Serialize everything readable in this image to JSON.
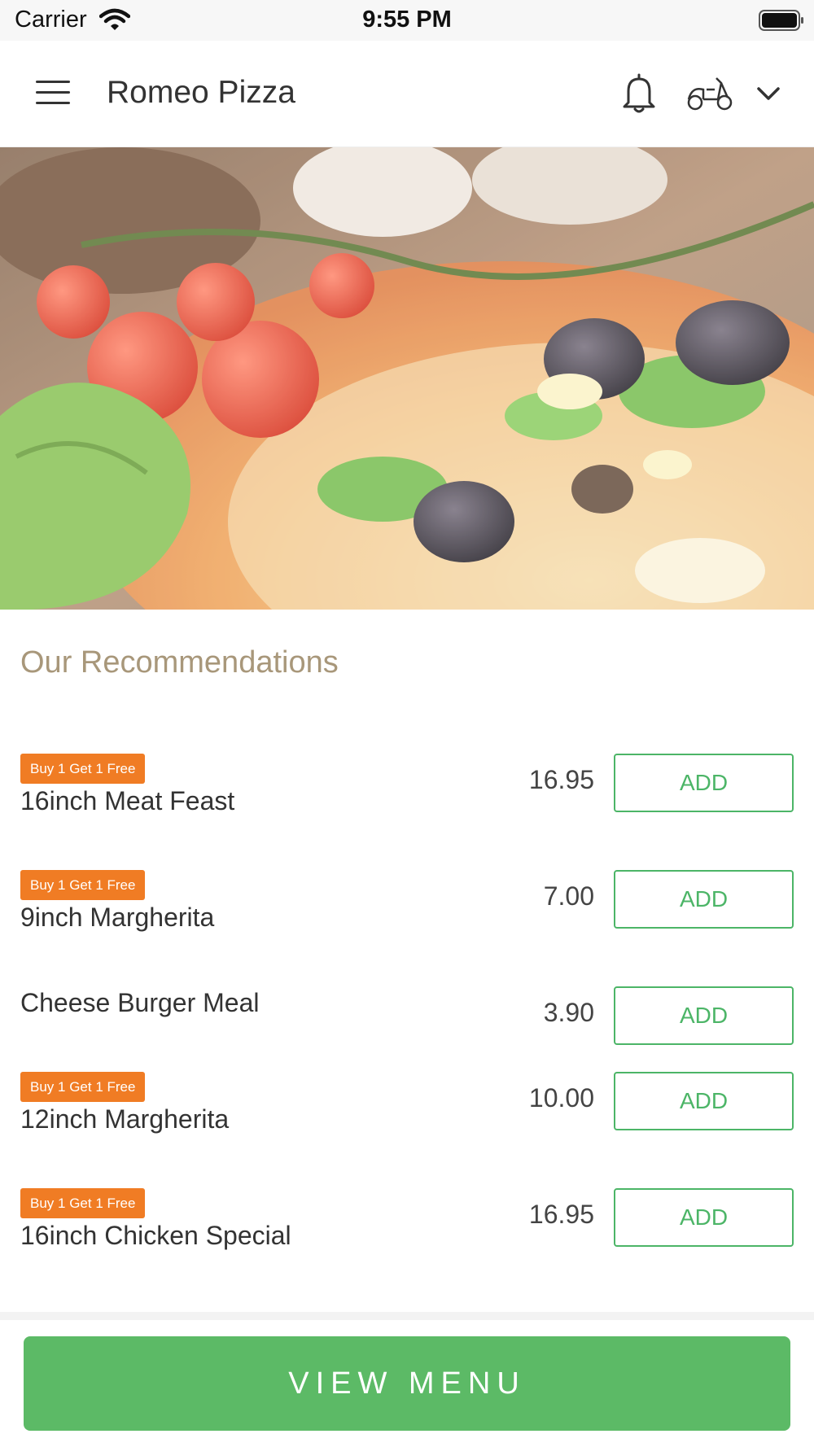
{
  "status_bar": {
    "carrier": "Carrier",
    "time": "9:55 PM"
  },
  "header": {
    "title": "Romeo Pizza",
    "icons": [
      "menu-icon",
      "bell-icon",
      "scooter-icon",
      "chevron-down-icon"
    ]
  },
  "section": {
    "title": "Our Recommendations"
  },
  "items": [
    {
      "badge": "Buy 1 Get 1 Free",
      "name": "16inch Meat Feast",
      "price": "16.95",
      "add_label": "ADD"
    },
    {
      "badge": "Buy 1 Get 1 Free",
      "name": "9inch Margherita",
      "price": "7.00",
      "add_label": "ADD"
    },
    {
      "badge": "",
      "name": "Cheese Burger Meal",
      "price": "3.90",
      "add_label": "ADD"
    },
    {
      "badge": "Buy 1 Get 1 Free",
      "name": "12inch Margherita",
      "price": "10.00",
      "add_label": "ADD"
    },
    {
      "badge": "Buy 1 Get 1 Free",
      "name": "16inch Chicken Special",
      "price": "16.95",
      "add_label": "ADD"
    }
  ],
  "footer": {
    "view_menu_label": "VIEW MENU"
  },
  "colors": {
    "badge": "#f07c24",
    "accent_green": "#5cba66",
    "section_title": "#a8977a"
  }
}
